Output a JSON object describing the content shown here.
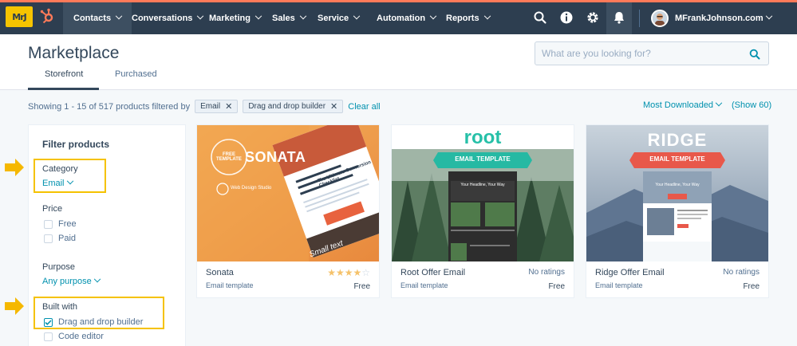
{
  "nav": {
    "logo_text": "MrJ",
    "items": [
      {
        "label": "Contacts",
        "active": true
      },
      {
        "label": "Conversations"
      },
      {
        "label": "Marketing"
      },
      {
        "label": "Sales"
      },
      {
        "label": "Service"
      },
      {
        "label": "Automation"
      },
      {
        "label": "Reports"
      }
    ],
    "icons": [
      "search-icon",
      "info-icon",
      "gear-icon",
      "bell-icon"
    ],
    "user_name": "MFrankJohnson.com",
    "colors": {
      "bar": "#2d3e50",
      "accent": "#ff7a59",
      "hubspot_orange": "#ff7a59"
    }
  },
  "header": {
    "title": "Marketplace",
    "search_placeholder": "What are you looking for?",
    "tabs": [
      {
        "label": "Storefront",
        "active": true
      },
      {
        "label": "Purchased"
      }
    ]
  },
  "results": {
    "showing_prefix": "Showing",
    "range": "1 - 15",
    "of_word": "of",
    "total": "517",
    "suffix": "products filtered by",
    "filters": [
      "Email",
      "Drag and drop builder"
    ],
    "clear_all": "Clear all",
    "sort_label": "Most Downloaded",
    "show_count": "(Show 60)"
  },
  "sidebar": {
    "heading": "Filter products",
    "category_label": "Category",
    "category_value": "Email",
    "price_label": "Price",
    "price_options": [
      {
        "label": "Free",
        "checked": false
      },
      {
        "label": "Paid",
        "checked": false
      }
    ],
    "purpose_label": "Purpose",
    "purpose_value": "Any purpose",
    "built_with_label": "Built with",
    "built_with_options": [
      {
        "label": "Drag and drop builder",
        "checked": true
      },
      {
        "label": "Code editor",
        "checked": false
      }
    ],
    "highlight_color": "#f5c200"
  },
  "products": [
    {
      "name": "Sonata",
      "type": "Email template",
      "price": "Free",
      "rating": 4,
      "rating_text": "",
      "image_title": "SONATA",
      "image_badge": "FREE TEMPLATE",
      "image_brand": "Web Design Studio",
      "image_headline": "The Ultimate Conversion Checklist",
      "image_cta": "Get The Checklist",
      "image_script": "Small text"
    },
    {
      "name": "Root Offer Email",
      "type": "Email template",
      "price": "Free",
      "rating_text": "No ratings",
      "image_title": "root",
      "image_banner": "EMAIL TEMPLATE",
      "image_headline": "Your Headline, Your Way"
    },
    {
      "name": "Ridge Offer Email",
      "type": "Email template",
      "price": "Free",
      "rating_text": "No ratings",
      "image_title": "RIDGE",
      "image_banner": "EMAIL TEMPLATE",
      "image_headline": "Your Headline, Your Way"
    }
  ]
}
